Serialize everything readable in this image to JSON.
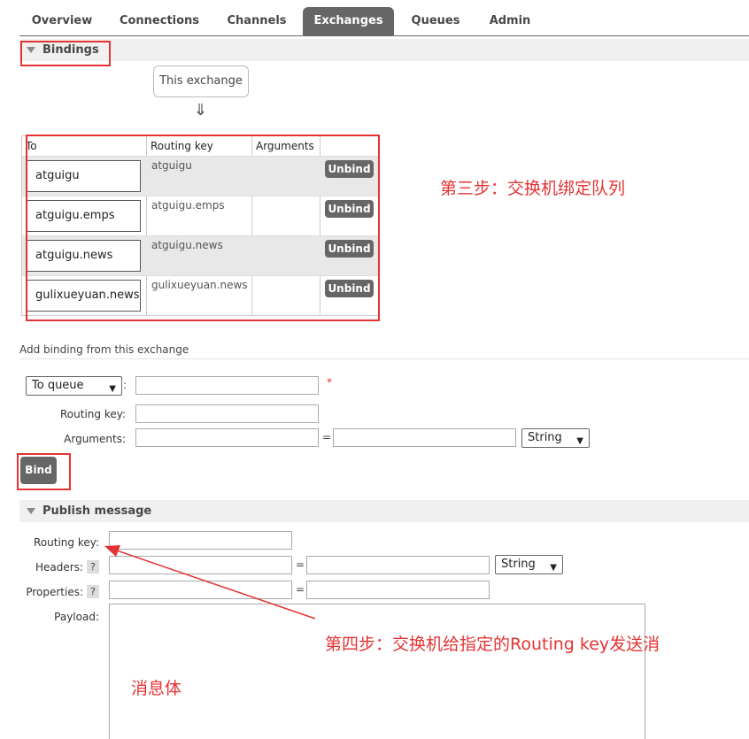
{
  "tabs": [
    {
      "label": "Overview"
    },
    {
      "label": "Connections"
    },
    {
      "label": "Channels"
    },
    {
      "label": "Exchanges"
    },
    {
      "label": "Queues"
    },
    {
      "label": "Admin"
    }
  ],
  "active_tab": "Exchanges",
  "bindings": {
    "title": "Bindings",
    "this_exchange": "This exchange",
    "arrow": "⇓",
    "columns": {
      "to": "To",
      "routing_key": "Routing key",
      "arguments": "Arguments"
    },
    "rows": [
      {
        "queue": "atguigu",
        "routing_key": "atguigu",
        "arguments": "",
        "action": "Unbind"
      },
      {
        "queue": "atguigu.emps",
        "routing_key": "atguigu.emps",
        "arguments": "",
        "action": "Unbind"
      },
      {
        "queue": "atguigu.news",
        "routing_key": "atguigu.news",
        "arguments": "",
        "action": "Unbind"
      },
      {
        "queue": "gulixueyuan.news",
        "routing_key": "gulixueyuan.news",
        "arguments": "",
        "action": "Unbind"
      }
    ]
  },
  "add_binding": {
    "title": "Add binding from this exchange",
    "destination_select": "To queue",
    "colon": ":",
    "required_mark": "*",
    "routing_key_label": "Routing key:",
    "arguments_label": "Arguments:",
    "equals": "=",
    "type_select": "String",
    "bind_button": "Bind"
  },
  "publish": {
    "title": "Publish message",
    "routing_key_label": "Routing key:",
    "headers_label": "Headers:",
    "properties_label": "Properties:",
    "help": "?",
    "equals": "=",
    "type_select": "String",
    "payload_label": "Payload:"
  },
  "annotations": {
    "step3": "第三步：交换机绑定队列",
    "step4": "第四步：交换机给指定的Routing key发送消",
    "payload_note": "消息体"
  },
  "colors": {
    "accent_red": "#e53333",
    "tab_active": "#666666",
    "button": "#666666"
  }
}
